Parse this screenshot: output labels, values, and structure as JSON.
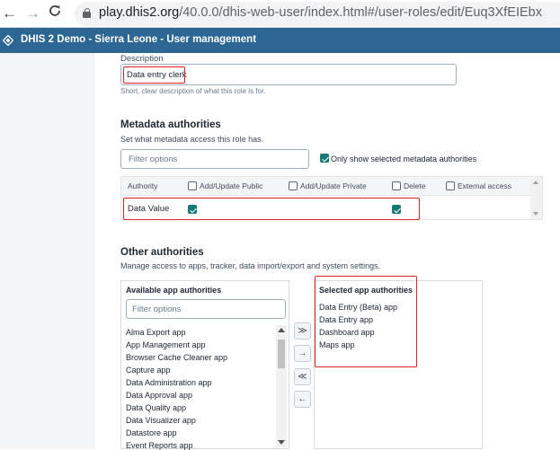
{
  "browser": {
    "back_icon": "arrow-left-icon",
    "back_glyph": "←",
    "forward_icon": "arrow-right-icon",
    "forward_glyph": "→",
    "reload_icon": "reload-icon",
    "reload_glyph": "C",
    "url_host": "play.dhis2.org",
    "url_path": "/40.0.0/dhis-web-user/index.html#/user-roles/edit/Euq3XfEIEbx"
  },
  "header": {
    "title": "DHIS 2 Demo - Sierra Leone - User management",
    "background": "#2c6693"
  },
  "description": {
    "label": "Description",
    "value": "Data entry clerk",
    "helper": "Short, clear description of what this role is for."
  },
  "metadata": {
    "title": "Metadata authorities",
    "subtitle": "Set what metadata access this role has.",
    "filter_placeholder": "Filter options",
    "only_selected_label": "Only show selected metadata authorities",
    "only_selected_checked": true,
    "columns": {
      "authority": "Authority",
      "add_update_public": "Add/Update Public",
      "add_update_private": "Add/Update Private",
      "delete": "Delete",
      "external_access": "External access"
    },
    "rows": [
      {
        "authority": "Data Value",
        "add_update_public": true,
        "add_update_private": false,
        "delete": true,
        "external_access": false
      }
    ]
  },
  "other": {
    "title": "Other authorities",
    "subtitle": "Manage access to apps, tracker, data import/export and system settings.",
    "available": {
      "title": "Available app authorities",
      "filter_placeholder": "Filter options",
      "items": [
        "Alma Export app",
        "App Management app",
        "Browser Cache Cleaner app",
        "Capture app",
        "Data Administration app",
        "Data Approval app",
        "Data Quality app",
        "Data Visualizer app",
        "Datastore app",
        "Event Reports app"
      ]
    },
    "selected": {
      "title": "Selected app authorities",
      "items": [
        "Data Entry (Beta) app",
        "Data Entry app",
        "Dashboard app",
        "Maps app"
      ]
    },
    "buttons": {
      "select_all": "≫",
      "select": "→",
      "deselect_all": "≪",
      "deselect": "←"
    }
  },
  "colors": {
    "highlight": "#e02424",
    "checkbox_checked": "#147a73"
  }
}
